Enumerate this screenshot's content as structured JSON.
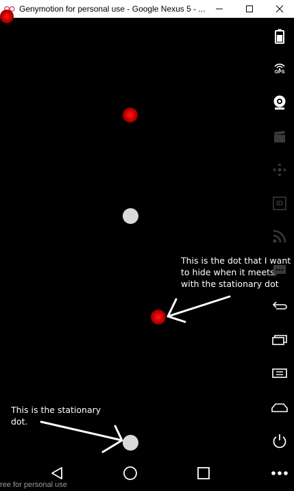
{
  "window": {
    "title": "Genymotion for personal use - Google Nexus 5 - ...",
    "minimize_icon": "minimize-icon",
    "maximize_icon": "maximize-icon",
    "close_icon": "close-icon"
  },
  "annotations": {
    "moving_dot_note": "This is the dot that I want to hide when it meets with the stationary dot",
    "moving_dot_lines": [
      "This is the dot that I want",
      "to hide when it meets",
      "with the stationary dot"
    ],
    "stationary_dot_lines": [
      "This is the stationary",
      "dot."
    ]
  },
  "toolbar": {
    "items": [
      {
        "name": "battery-icon"
      },
      {
        "name": "gps-icon",
        "label": "GPS"
      },
      {
        "name": "webcam-icon"
      },
      {
        "name": "capture-icon"
      },
      {
        "name": "dpad-icon"
      },
      {
        "name": "id-icon",
        "label": "ID"
      },
      {
        "name": "rss-icon"
      },
      {
        "name": "sms-icon"
      },
      {
        "name": "back-icon"
      },
      {
        "name": "recent-apps-icon"
      },
      {
        "name": "menu-icon"
      },
      {
        "name": "home-icon"
      },
      {
        "name": "power-icon"
      }
    ]
  },
  "navbar": {
    "back": "nav-back-icon",
    "home": "nav-home-icon",
    "recents": "nav-recents-icon",
    "more": "more-icon"
  },
  "watermark": "ree for personal use",
  "colors": {
    "background": "#000000",
    "red_dot": "#cc0000",
    "grey_dot": "#d9d9d9",
    "annotation_text": "#ffffff"
  }
}
